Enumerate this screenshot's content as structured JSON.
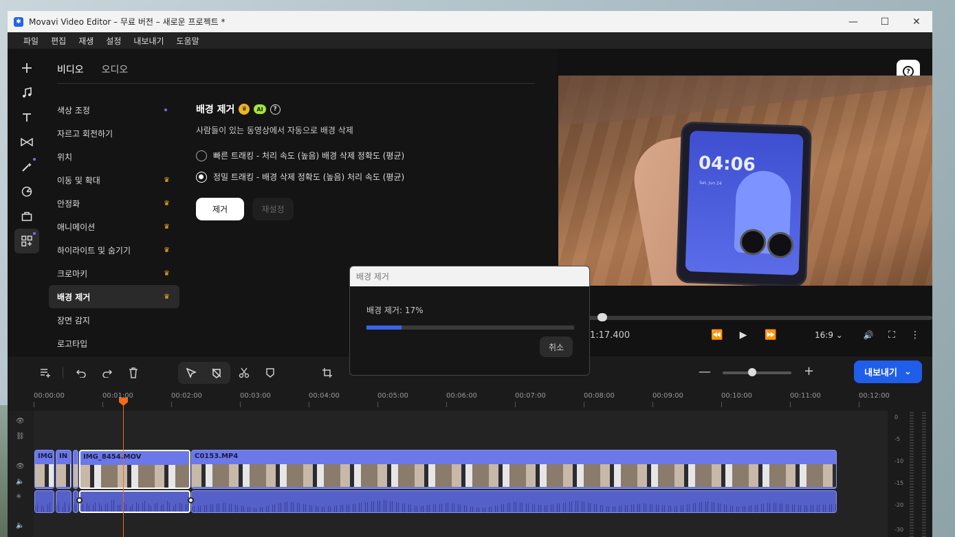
{
  "window": {
    "title": "Movavi Video Editor – 무료 버전 – 새로운 프로젝트 *",
    "minimize": "—",
    "maximize": "☐",
    "close": "✕"
  },
  "menu": [
    "파일",
    "편집",
    "재생",
    "설정",
    "내보내기",
    "도움말"
  ],
  "rail": [
    "add-icon",
    "music-icon",
    "text-icon",
    "transition-icon",
    "magic-icon",
    "sticker-icon",
    "toolbox-icon",
    "more-tools-icon"
  ],
  "tabs": {
    "video": "비디오",
    "audio": "오디오"
  },
  "effects": [
    {
      "label": "색상 조정"
    },
    {
      "label": "자르고 회전하기"
    },
    {
      "label": "위치"
    },
    {
      "label": "이동 및 확대"
    },
    {
      "label": "안정화"
    },
    {
      "label": "애니메이션"
    },
    {
      "label": "하이라이트 및 숨기기"
    },
    {
      "label": "크로마키"
    },
    {
      "label": "배경 제거"
    },
    {
      "label": "장면 감지"
    },
    {
      "label": "로고타입"
    }
  ],
  "detail": {
    "title": "배경 제거",
    "ai_badge": "AI",
    "help": "?",
    "description": "사람들이 있는 동영상에서 자동으로 배경 삭제",
    "option_fast": "빠른 트래킹 - 처리 속도 (높음) 배경 삭제 정확도 (평균)",
    "option_precise": "정밀 트래킹 - 배경 삭제 정확도 (높음) 처리 속도 (평균)",
    "remove_button": "제거",
    "reset_button": "재설정"
  },
  "preview": {
    "help": "?",
    "phone_time": "04:06",
    "phone_date": "Sat, Jun 24",
    "timecode": "1:17.400",
    "ratio": "16:9 ⌄",
    "rewind": "⏪",
    "play": "▶",
    "forward": "⏩",
    "volume": "🔊",
    "fullscreen": "⛶",
    "more": "⋮"
  },
  "dialog": {
    "title": "배경 제거",
    "progress_label": "배경 제거: 17%",
    "progress": 0.17,
    "cancel": "취소"
  },
  "timeline_toolbar": {
    "export": "내보내기",
    "export_arrow": "⌄",
    "zoom_minus": "—",
    "zoom_plus": "+",
    "zoom_level": 0.37
  },
  "ruler": [
    "00:00:00",
    "00:01:00",
    "00:02:00",
    "00:03:00",
    "00:04:00",
    "00:05:00",
    "00:06:00",
    "00:07:00",
    "00:08:00",
    "00:09:00",
    "00:10:00",
    "00:11:00",
    "00:12:00"
  ],
  "clips": [
    "IMG",
    "IN",
    "",
    "IMG_8454.MOV",
    "C0153.MP4"
  ],
  "meter": [
    "0",
    "-5",
    "-10",
    "-15",
    "-20",
    "-30"
  ]
}
